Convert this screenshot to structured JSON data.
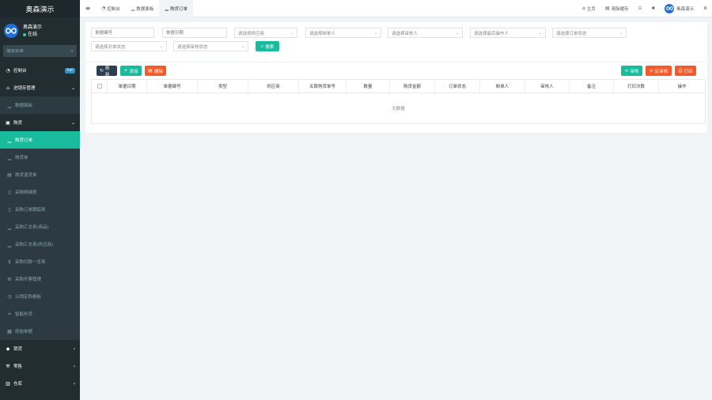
{
  "sidebar": {
    "brand": "奥森演示",
    "user": {
      "name": "奥森演示",
      "status": "在线"
    },
    "search_placeholder": "搜索菜单",
    "items": [
      {
        "label": "控制台",
        "icon": "dashboard-icon",
        "badge": "hot"
      },
      {
        "label": "进销存管理",
        "icon": "graduation-cap-icon",
        "caret": "⌄"
      },
      {
        "label": "数据面板",
        "icon": "chart-icon"
      },
      {
        "label": "购货",
        "icon": "truck-icon",
        "caret": "⌄"
      },
      {
        "label": "购货订单",
        "icon": "chart-icon"
      },
      {
        "label": "购货单",
        "icon": "chart-icon"
      },
      {
        "label": "购货退货单",
        "icon": "document-icon"
      },
      {
        "label": "采购明细表",
        "icon": "document-icon"
      },
      {
        "label": "采购订单跟踪表",
        "icon": "document-icon"
      },
      {
        "label": "采购汇总表(商品)",
        "icon": "chart-icon"
      },
      {
        "label": "采购汇总表(供应商)",
        "icon": "chart-icon"
      },
      {
        "label": "采购付款一览表",
        "icon": "dollar-icon"
      },
      {
        "label": "采购开票管理",
        "icon": "gear-icon"
      },
      {
        "label": "以销定购看板",
        "icon": "clock-icon"
      },
      {
        "label": "智能补货",
        "icon": "smart-icon"
      },
      {
        "label": "原始单据",
        "icon": "book-icon"
      },
      {
        "label": "销货",
        "icon": "tag-icon",
        "caret": "‹"
      },
      {
        "label": "零售",
        "icon": "wrench-icon",
        "caret": "‹"
      },
      {
        "label": "仓库",
        "icon": "building-icon",
        "caret": "‹"
      }
    ]
  },
  "topbar": {
    "tabs": [
      {
        "label": "控制台",
        "icon": "dashboard-icon"
      },
      {
        "label": "数据面板",
        "icon": "chart-icon"
      },
      {
        "label": "购货订单",
        "icon": "chart-icon"
      }
    ],
    "home": "主页",
    "clear_cache": "清除缓存",
    "user": "奥森演示"
  },
  "filters": {
    "order_no": "单据编号",
    "order_date": "单据日期",
    "supplier": "请选择供应商",
    "maker": "请选择制单人",
    "auditor": "请选择审核人",
    "last_operator": "请选择最后操作人",
    "order_status": "请选择订单状态",
    "check_status": "请选择对单状态",
    "audit_status": "请选择审核状态",
    "search_label": "搜索"
  },
  "toolbar": {
    "refresh": "刷新",
    "add": "添加",
    "delete": "删除",
    "audit": "审核",
    "unaudit": "反审核",
    "print": "打印"
  },
  "table": {
    "columns": [
      "单据日期",
      "单据编号",
      "类型",
      "供应商",
      "关联购货单号",
      "数量",
      "购货金额",
      "订单状态",
      "制单人",
      "审核人",
      "备注",
      "打印次数",
      "操作"
    ],
    "empty": "无数据"
  }
}
